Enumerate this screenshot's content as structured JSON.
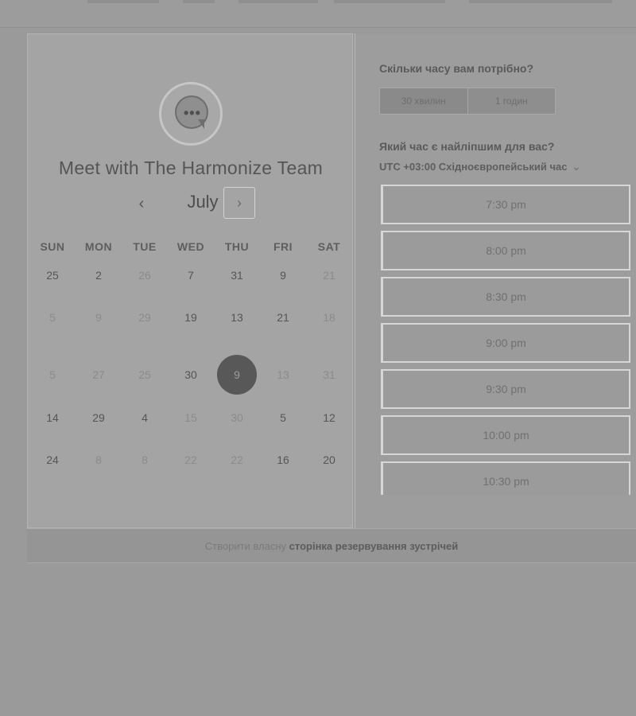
{
  "colors": {
    "background": "#9a9a9a",
    "calendar_panel": "#a4a4a4",
    "selected_day": "#585858",
    "slot_border": "#d6d6d6"
  },
  "booking": {
    "title": "Meet with The Harmonize Team",
    "avatar_icon": "chat-bubble-dots-icon"
  },
  "calendar": {
    "month": "July",
    "prev_icon": "chevron-left-icon",
    "next_icon": "chevron-right-icon",
    "weekdays": [
      "SUN",
      "MON",
      "TUE",
      "WED",
      "THU",
      "FRI",
      "SAT"
    ],
    "weeks": [
      [
        {
          "d": "25",
          "dim": false
        },
        {
          "d": "2",
          "dim": false
        },
        {
          "d": "26",
          "dim": true
        },
        {
          "d": "7",
          "dim": false
        },
        {
          "d": "31",
          "dim": false
        },
        {
          "d": "9",
          "dim": false
        },
        {
          "d": "21",
          "dim": true
        }
      ],
      [
        {
          "d": "5",
          "dim": true
        },
        {
          "d": "9",
          "dim": true
        },
        {
          "d": "29",
          "dim": true
        },
        {
          "d": "19",
          "dim": false
        },
        {
          "d": "13",
          "dim": false
        },
        {
          "d": "21",
          "dim": false
        },
        {
          "d": "18",
          "dim": true
        }
      ],
      [
        {
          "d": "5",
          "dim": true
        },
        {
          "d": "27",
          "dim": true
        },
        {
          "d": "25",
          "dim": true
        },
        {
          "d": "30",
          "dim": false
        },
        {
          "d": "9",
          "dim": false,
          "selected": true
        },
        {
          "d": "13",
          "dim": true
        },
        {
          "d": "31",
          "dim": true
        }
      ],
      [
        {
          "d": "14",
          "dim": false
        },
        {
          "d": "29",
          "dim": false
        },
        {
          "d": "4",
          "dim": false
        },
        {
          "d": "15",
          "dim": true
        },
        {
          "d": "30",
          "dim": true
        },
        {
          "d": "5",
          "dim": false
        },
        {
          "d": "12",
          "dim": false
        }
      ],
      [
        {
          "d": "24",
          "dim": false
        },
        {
          "d": "8",
          "dim": true
        },
        {
          "d": "8",
          "dim": true
        },
        {
          "d": "22",
          "dim": true
        },
        {
          "d": "22",
          "dim": true
        },
        {
          "d": "16",
          "dim": false
        },
        {
          "d": "20",
          "dim": false
        }
      ]
    ]
  },
  "duration": {
    "question": "Скільки часу вам потрібно?",
    "options": [
      "30 хвилин",
      "1 годин"
    ],
    "selected": "30 хвилин"
  },
  "time": {
    "question": "Який час є найліпшим для вас?",
    "timezone": "UTC +03:00 Східноєвропейський час",
    "timezone_icon": "chevron-down-icon",
    "slots": [
      "7:30 pm",
      "8:00 pm",
      "8:30 pm",
      "9:00 pm",
      "9:30 pm",
      "10:00 pm",
      "10:30 pm"
    ]
  },
  "footer": {
    "prefix": "Створити власну",
    "link": "сторінка резервування зустрічей"
  }
}
